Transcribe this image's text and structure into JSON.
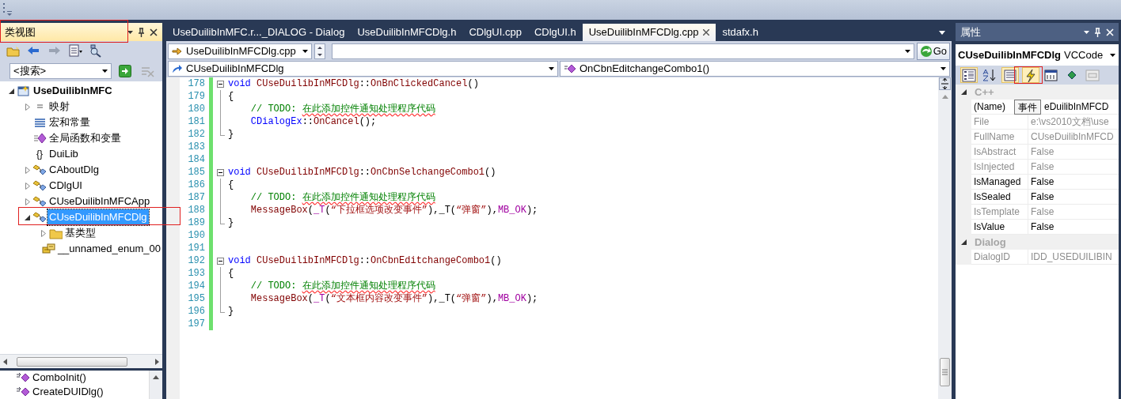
{
  "class_view": {
    "title": "类视图",
    "search": {
      "value": "<搜索>"
    },
    "tree": [
      {
        "label": "UseDuilibInMFC",
        "kind": "project",
        "expanded": true,
        "selected": false,
        "bold": true,
        "children": [
          {
            "label": "映射",
            "kind": "map",
            "expanded": false,
            "selected": false,
            "bold": false
          },
          {
            "label": "宏和常量",
            "kind": "macro",
            "selected": false,
            "bold": false
          },
          {
            "label": "全局函数和变量",
            "kind": "global",
            "selected": false,
            "bold": false
          },
          {
            "label": "DuiLib",
            "kind": "namespace",
            "icon_text": "{}",
            "selected": false,
            "bold": false
          },
          {
            "label": "CAboutDlg",
            "kind": "class",
            "expanded": false,
            "selected": false,
            "bold": false
          },
          {
            "label": "CDlgUI",
            "kind": "class",
            "expanded": false,
            "selected": false,
            "bold": false
          },
          {
            "label": "CUseDuilibInMFCApp",
            "kind": "class",
            "expanded": false,
            "selected": false,
            "bold": false
          },
          {
            "label": "CUseDuilibInMFCDlg",
            "kind": "class",
            "expanded": true,
            "selected": true,
            "bold": false,
            "children": [
              {
                "label": "基类型",
                "kind": "folder",
                "expanded": false,
                "selected": false,
                "bold": false
              },
              {
                "label": "__unnamed_enum_00",
                "kind": "enum",
                "selected": false,
                "bold": false
              }
            ]
          }
        ]
      }
    ],
    "members": [
      {
        "label": "ComboInit()"
      },
      {
        "label": "CreateDUIDlg()"
      }
    ]
  },
  "editor": {
    "tabs": [
      {
        "label": "UseDuilibInMFC.r..._DIALOG - Dialog",
        "selected": false
      },
      {
        "label": "UseDuilibInMFCDlg.h",
        "selected": false
      },
      {
        "label": "CDlgUI.cpp",
        "selected": false
      },
      {
        "label": "CDlgUI.h",
        "selected": false
      },
      {
        "label": "UseDuilibInMFCDlg.cpp",
        "selected": true
      },
      {
        "label": "stdafx.h",
        "selected": false
      }
    ],
    "file_combo": {
      "value": "UseDuilibInMFCDlg.cpp"
    },
    "go_button": {
      "label": "Go"
    },
    "class_combo": {
      "value": "CUseDuilibInMFCDlg"
    },
    "member_combo": {
      "value": "OnCbnEditchangeCombo1()"
    },
    "lines": [
      {
        "number": "178",
        "kind": "head",
        "tokens": [
          {
            "kind": "keyword",
            "text": "void "
          },
          {
            "kind": "name",
            "text": "CUseDuilibInMFCDlg"
          },
          {
            "kind": "plain",
            "text": "::"
          },
          {
            "kind": "name",
            "text": "OnBnClickedCancel"
          },
          {
            "kind": "plain",
            "text": "()"
          }
        ]
      },
      {
        "number": "179",
        "kind": "body",
        "tokens": [
          {
            "kind": "plain",
            "text": "{"
          }
        ]
      },
      {
        "number": "180",
        "kind": "body",
        "tokens": [
          {
            "kind": "comment",
            "text": "    // TODO: "
          },
          {
            "kind": "flagged",
            "text": "在此添加控件通知处理程序代码"
          }
        ]
      },
      {
        "number": "181",
        "kind": "body",
        "tokens": [
          {
            "kind": "type",
            "text": "    CDialogEx"
          },
          {
            "kind": "plain",
            "text": "::"
          },
          {
            "kind": "name",
            "text": "OnCancel"
          },
          {
            "kind": "plain",
            "text": "();"
          }
        ]
      },
      {
        "number": "182",
        "kind": "tail",
        "tokens": [
          {
            "kind": "plain",
            "text": "}"
          }
        ]
      },
      {
        "number": "183",
        "kind": "blank"
      },
      {
        "number": "184",
        "kind": "blank"
      },
      {
        "number": "185",
        "kind": "head",
        "tokens": [
          {
            "kind": "keyword",
            "text": "void "
          },
          {
            "kind": "name",
            "text": "CUseDuilibInMFCDlg"
          },
          {
            "kind": "plain",
            "text": "::"
          },
          {
            "kind": "name",
            "text": "OnCbnSelchangeCombo1"
          },
          {
            "kind": "plain",
            "text": "()"
          }
        ]
      },
      {
        "number": "186",
        "kind": "body",
        "tokens": [
          {
            "kind": "plain",
            "text": "{"
          }
        ]
      },
      {
        "number": "187",
        "kind": "body",
        "tokens": [
          {
            "kind": "comment",
            "text": "    // TODO: "
          },
          {
            "kind": "flagged",
            "text": "在此添加控件通知处理程序代码"
          }
        ]
      },
      {
        "number": "188",
        "kind": "body",
        "tokens": [
          {
            "kind": "name",
            "text": "    MessageBox"
          },
          {
            "kind": "plain",
            "text": "("
          },
          {
            "kind": "macro",
            "text": "_T"
          },
          {
            "kind": "plain",
            "text": "("
          },
          {
            "kind": "string",
            "text": "“下拉框选项改变事件”"
          },
          {
            "kind": "plain",
            "text": "),_T("
          },
          {
            "kind": "string",
            "text": "“弹窗”"
          },
          {
            "kind": "plain",
            "text": "),"
          },
          {
            "kind": "macro",
            "text": "MB_OK"
          },
          {
            "kind": "plain",
            "text": ");"
          }
        ]
      },
      {
        "number": "189",
        "kind": "tail",
        "tokens": [
          {
            "kind": "plain",
            "text": "}"
          }
        ]
      },
      {
        "number": "190",
        "kind": "blank"
      },
      {
        "number": "191",
        "kind": "blank"
      },
      {
        "number": "192",
        "kind": "head",
        "tokens": [
          {
            "kind": "keyword",
            "text": "void "
          },
          {
            "kind": "name",
            "text": "CUseDuilibInMFCDlg"
          },
          {
            "kind": "plain",
            "text": "::"
          },
          {
            "kind": "name",
            "text": "OnCbnEditchangeCombo1"
          },
          {
            "kind": "plain",
            "text": "()"
          }
        ]
      },
      {
        "number": "193",
        "kind": "body",
        "tokens": [
          {
            "kind": "plain",
            "text": "{"
          }
        ]
      },
      {
        "number": "194",
        "kind": "body",
        "tokens": [
          {
            "kind": "comment",
            "text": "    // TODO: "
          },
          {
            "kind": "flagged",
            "text": "在此添加控件通知处理程序代码"
          }
        ]
      },
      {
        "number": "195",
        "kind": "body",
        "tokens": [
          {
            "kind": "name",
            "text": "    MessageBox"
          },
          {
            "kind": "plain",
            "text": "("
          },
          {
            "kind": "macro",
            "text": "_T"
          },
          {
            "kind": "plain",
            "text": "("
          },
          {
            "kind": "string",
            "text": "“文本框内容改变事件”"
          },
          {
            "kind": "plain",
            "text": "),_T("
          },
          {
            "kind": "string",
            "text": "“弹窗”"
          },
          {
            "kind": "plain",
            "text": "),"
          },
          {
            "kind": "macro",
            "text": "MB_OK"
          },
          {
            "kind": "plain",
            "text": ");"
          }
        ]
      },
      {
        "number": "196",
        "kind": "tail",
        "tokens": [
          {
            "kind": "plain",
            "text": "}"
          }
        ]
      },
      {
        "number": "197",
        "kind": "blank"
      }
    ]
  },
  "properties": {
    "title": "属性",
    "object": {
      "name": "CUseDuilibInMFCDlg",
      "type": "VCCode"
    },
    "toolbar": [
      {
        "kind": "categorized",
        "selected": true
      },
      {
        "kind": "alphabetical",
        "selected": false
      },
      {
        "kind": "properties",
        "selected": true
      },
      {
        "kind": "events",
        "selected": true
      },
      {
        "kind": "messages",
        "selected": false
      },
      {
        "kind": "overrides",
        "selected": false
      },
      {
        "kind": "pages",
        "selected": false
      }
    ],
    "tooltip": "事件",
    "categories": [
      {
        "name": "C++",
        "rows": [
          {
            "name": "(Name)",
            "value": "eDuilibInMFCD",
            "readonly": false
          },
          {
            "name": "File",
            "value": "e:\\vs2010文档\\use",
            "readonly": true
          },
          {
            "name": "FullName",
            "value": "CUseDuilibInMFCD",
            "readonly": true
          },
          {
            "name": "IsAbstract",
            "value": "False",
            "readonly": true
          },
          {
            "name": "IsInjected",
            "value": "False",
            "readonly": true
          },
          {
            "name": "IsManaged",
            "value": "False",
            "readonly": false
          },
          {
            "name": "IsSealed",
            "value": "False",
            "readonly": false
          },
          {
            "name": "IsTemplate",
            "value": "False",
            "readonly": true
          },
          {
            "name": "IsValue",
            "value": "False",
            "readonly": false
          }
        ]
      },
      {
        "name": "Dialog",
        "rows": [
          {
            "name": "DialogID",
            "value": "IDD_USEDUILIBIN",
            "readonly": true
          }
        ]
      }
    ]
  }
}
